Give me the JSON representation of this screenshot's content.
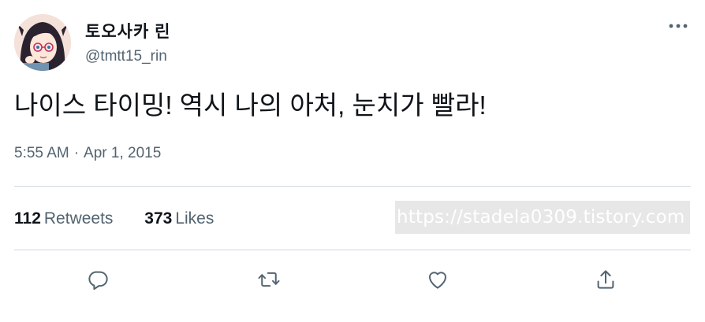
{
  "user": {
    "display_name": "토오사카 린",
    "handle": "@tmtt15_rin",
    "avatar_icon": "anime-girl-avatar"
  },
  "tweet": {
    "text": "나이스 타이밍! 역시 나의 아처, 눈치가 빨라!",
    "time": "5:55 AM",
    "separator": "·",
    "date": "Apr 1, 2015"
  },
  "stats": {
    "retweets_count": "112",
    "retweets_label": "Retweets",
    "likes_count": "373",
    "likes_label": "Likes"
  },
  "watermark": "https://stadela0309.tistory.com",
  "actions": {
    "reply_icon": "reply-icon",
    "retweet_icon": "retweet-icon",
    "like_icon": "heart-icon",
    "share_icon": "share-icon",
    "more_icon": "more-horizontal-icon"
  },
  "colors": {
    "text_primary": "#0f1419",
    "text_secondary": "#536471",
    "divider": "#cfd9de"
  }
}
